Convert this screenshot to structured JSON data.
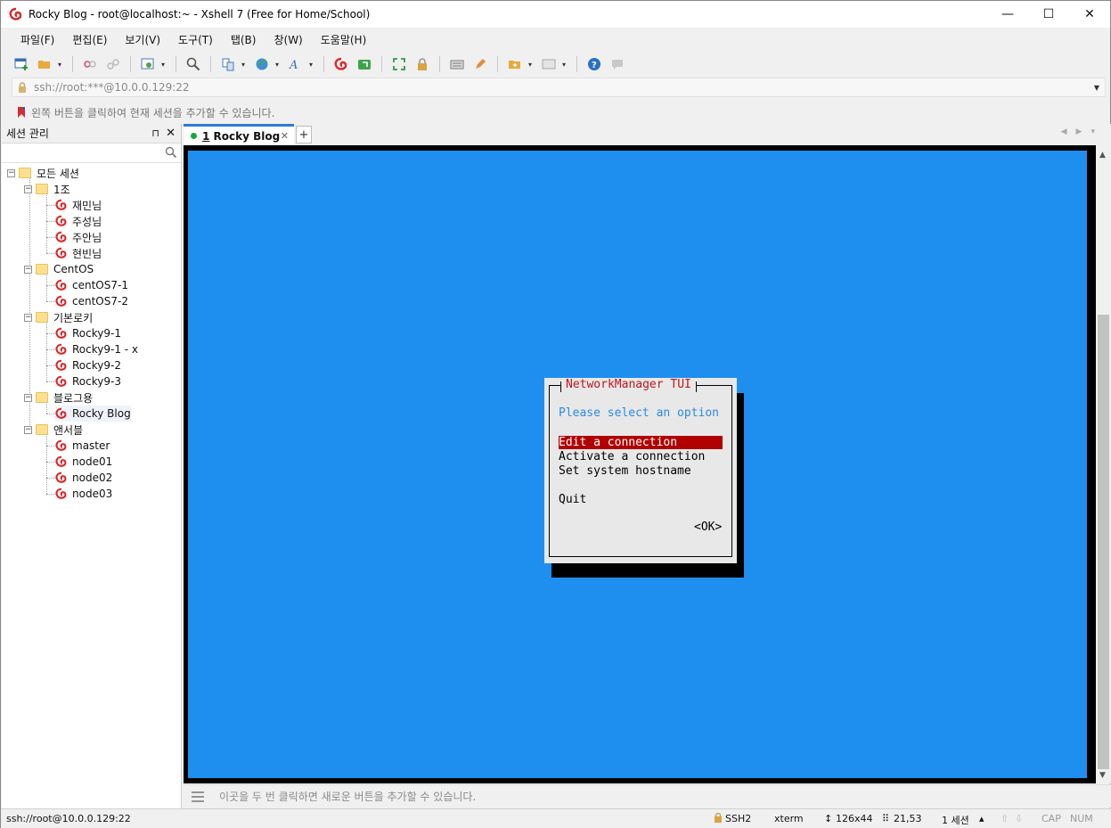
{
  "window": {
    "title": "Rocky Blog - root@localhost:~ - Xshell 7 (Free for Home/School)",
    "controls": [
      "—",
      "☐",
      "✕"
    ]
  },
  "menu": [
    "파일(F)",
    "편집(E)",
    "보기(V)",
    "도구(T)",
    "탭(B)",
    "창(W)",
    "도움말(H)"
  ],
  "address": {
    "value": "ssh://root:***@10.0.0.129:22"
  },
  "hint": "왼쪽 버튼을 클릭하여 현재 세션을 추가할 수 있습니다.",
  "sidepanel": {
    "title": "세션 관리",
    "pin": "⊓",
    "close": "✕",
    "search_placeholder": "",
    "tree": {
      "root": "모든 세션",
      "groups": [
        {
          "name": "1조",
          "items": [
            "재민님",
            "주성님",
            "주안님",
            "현빈님"
          ]
        },
        {
          "name": "CentOS",
          "items": [
            "centOS7-1",
            "centOS7-2"
          ]
        },
        {
          "name": "기본로키",
          "items": [
            "Rocky9-1",
            "Rocky9-1 - x",
            "Rocky9-2",
            "Rocky9-3"
          ]
        },
        {
          "name": "블로그용",
          "items": [
            "Rocky Blog"
          ]
        },
        {
          "name": "앤서블",
          "items": [
            "master",
            "node01",
            "node02",
            "node03"
          ]
        }
      ]
    }
  },
  "tabs": [
    {
      "num": "1",
      "label": "Rocky Blog",
      "close": "✕",
      "active": true
    }
  ],
  "tab_add": "+",
  "dialog": {
    "title": "NetworkManager TUI",
    "prompt": "Please select an option",
    "options": [
      "Edit a connection",
      "Activate a connection",
      "Set system hostname"
    ],
    "quit": "Quit",
    "ok": "<OK>",
    "selected_index": 0
  },
  "bottom_hint": "이곳을 두 번 클릭하면 새로운 버튼을 추가할 수 있습니다.",
  "status": {
    "connection": "ssh://root@10.0.0.129:22",
    "protocol": "SSH2",
    "term": "xterm",
    "size": "126x44",
    "cursor": "21,53",
    "sessions": "1 세션",
    "cap": "CAP",
    "num": "NUM"
  },
  "colors": {
    "terminal_bg": "#1e8fef",
    "dialog_bg": "#e8e8e8",
    "dialog_title": "#c0141a",
    "prompt": "#2a8ae4",
    "selection": "#b00000",
    "tab_accent": "#2e7bd6"
  }
}
